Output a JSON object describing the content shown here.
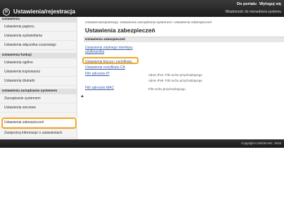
{
  "header": {
    "portal_link": "Do portalu",
    "logout_link": "Wyloguj się",
    "app_title": "Ustawienia/rejestracja",
    "right_text": "Wiadomość do menedżera systemu",
    "app_icon": "gear-icon"
  },
  "sidebar": {
    "section1": "Ustawienia",
    "items1": [
      "Ustawienia papieru",
      "Ustawienia wyświetlania",
      "Ustawienia włącznika czasowego"
    ],
    "section2": "Ustawienia funkcji",
    "items2": [
      "Ustawienia ogólne",
      "Ustawienia kopiowania",
      "Ustawienia drukarki"
    ],
    "section3": "Ustawienia zarządzania systemem",
    "items3": [
      "Zarządzanie systemem",
      "Ustawienia sieciowe",
      "Ustawienia zabezpieczeń",
      "Zarejestruj informacje o ustawieniach"
    ]
  },
  "main": {
    "breadcrumb": "Ustawienia/rejestracja: Ustawienia zarządzania systemem: Ustawienia zabezpieczeń",
    "title": "Ustawienia zabezpieczeń",
    "section": "Ustawienia zabezpieczeń",
    "link1a": "Ustawienia zdalnego interfejsu",
    "link1b": "użytkownika",
    "link2": "Ustawienia klucza i certyfikatu",
    "link3": "Ustawienia certyfikatu CA",
    "link4": "Filtr adresów IP",
    "note4a": "Adres IPv4: Filtr ruchu przychodzącego",
    "note4b": "Adres IPv6: Filtr ruchu przychodzącego",
    "link5": "Filtr adresów MAC",
    "note5": "Filtr ruchu przychodzącego",
    "up_icon": "up-arrow-icon"
  },
  "footer": {
    "copyright": "Copyright CANON INC. 2015"
  }
}
